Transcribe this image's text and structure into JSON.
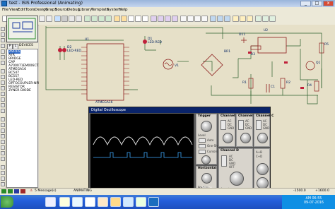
{
  "window": {
    "title": "test - ISIS Professional (Animating)"
  },
  "menu": [
    "File",
    "View",
    "Edit",
    "Tools",
    "Design",
    "Graph",
    "Source",
    "Debug",
    "Library",
    "Template",
    "System",
    "Help"
  ],
  "device_panel": {
    "mode_buttons": "P  L",
    "header": "DEVICES",
    "items": [
      "AVR16",
      "AYR",
      "BRIDGE",
      "CAP",
      "A700071EM006CT2/0",
      "ATMEGA16",
      "BC547",
      "BC557",
      "LED-RED",
      "OPTOCOUPLER-NPN",
      "RESISTOR",
      "ZYNER DIODE"
    ],
    "selected_index": 0
  },
  "schematic": {
    "labels": {
      "u1": "U1",
      "u1_part": "ATMEGA16",
      "d1": "D1",
      "d1_part": "LED-RED",
      "d2": "D2",
      "d2_part": "LED-RED",
      "d11": "D11",
      "u2": "U2",
      "br1": "BR1",
      "r1": "R1",
      "r2": "R2",
      "r3": "R3",
      "r4": "R4",
      "r5": "R5",
      "c1": "C1",
      "q1": "Q1",
      "v1": "V1"
    }
  },
  "oscilloscope": {
    "title": "Digital Oscilloscope",
    "channels": [
      "Channel A",
      "Channel B",
      "Channel C",
      "Channel D"
    ],
    "sections": {
      "trigger": "Trigger",
      "horizontal": "Horizontal"
    },
    "labels": {
      "ac": "AC",
      "dc": "DC",
      "gnd": "GND",
      "off": "OFF",
      "invert": "Invert",
      "position": "Position",
      "level": "Level",
      "auto": "Auto",
      "one_shot": "One-Shot",
      "cursors": "Cursors",
      "source": "Source",
      "ab": "A+B",
      "cd": "C+D"
    }
  },
  "status": {
    "messages": "5 Message(s)",
    "state": "ANIMATING",
    "coord_x": "-1500.0",
    "coord_y": "+1600.0"
  },
  "taskbar": {
    "time": "AM 06:55",
    "date": "09-07-2016",
    "colors": {
      "bar": "#245edb",
      "start": "#3a8f34"
    }
  }
}
